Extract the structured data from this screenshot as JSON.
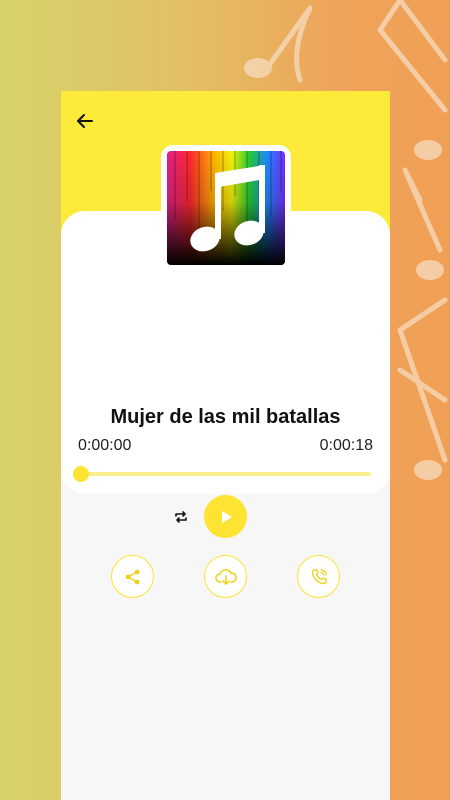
{
  "song": {
    "title": "Mujer de las mil batallas",
    "current_time": "0:00:00",
    "duration": "0:00:18",
    "progress": 0.0
  },
  "icons": {
    "back": "arrow-left-icon",
    "repeat": "repeat-icon",
    "play": "play-icon",
    "share": "share-icon",
    "download": "cloud-download-icon",
    "ringtone": "phone-call-icon",
    "album_art": "music-note-icon"
  },
  "colors": {
    "accent": "#fde332",
    "header": "#fdea3b",
    "track": "#fbef8c"
  }
}
